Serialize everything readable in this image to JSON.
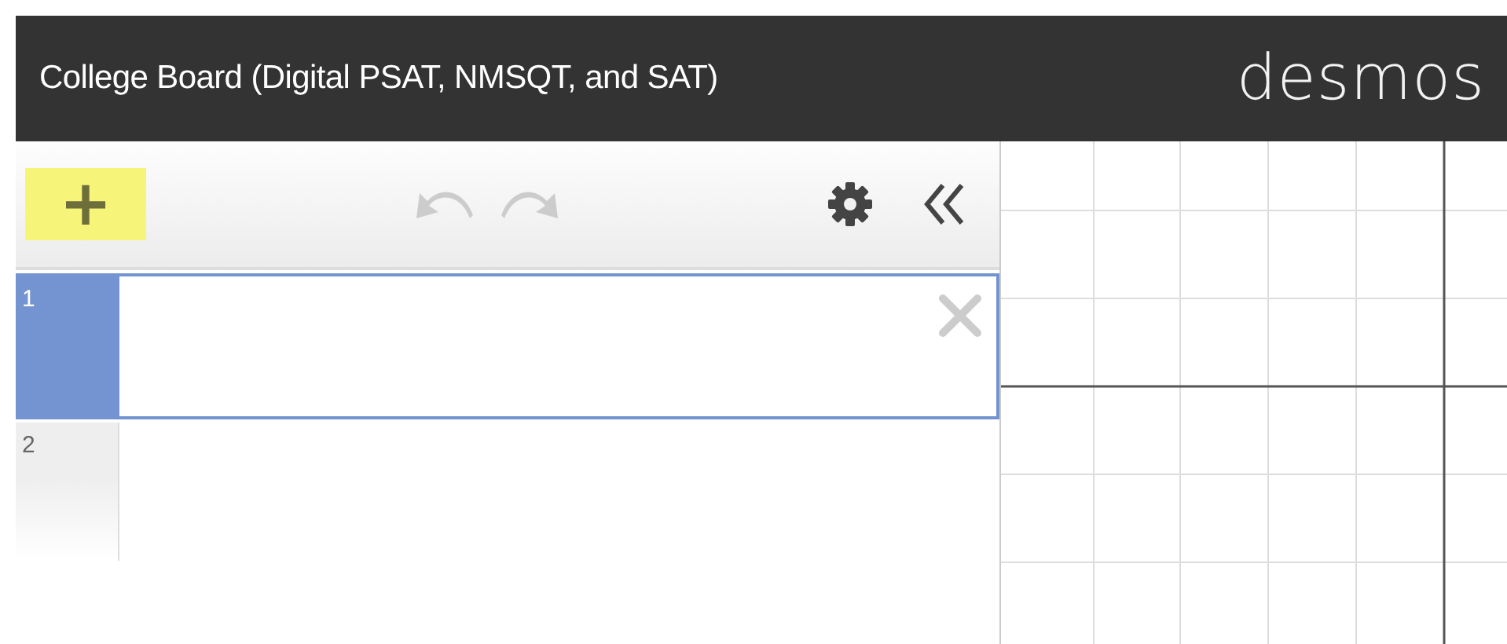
{
  "header": {
    "title": "College Board (Digital PSAT, NMSQT, and SAT)",
    "logo": "desmos"
  },
  "toolbar": {
    "add_button": {
      "label": "+",
      "highlighted": true
    }
  },
  "expressions": [
    {
      "number": "1",
      "selected": true
    },
    {
      "number": "2",
      "selected": false
    }
  ]
}
